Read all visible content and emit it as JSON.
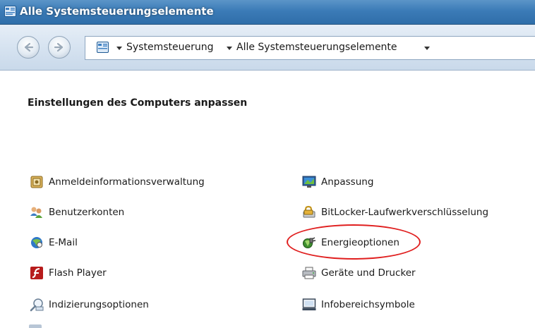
{
  "window": {
    "title": "Alle Systemsteuerungselemente",
    "title_icon": "control-panel-icon"
  },
  "navigation": {
    "back_icon": "back-arrow-icon",
    "forward_icon": "forward-arrow-icon",
    "breadcrumb": [
      "Systemsteuerung",
      "Alle Systemsteuerungselemente"
    ]
  },
  "main": {
    "heading": "Einstellungen des Computers anpassen",
    "items_left": [
      {
        "label": "Anmeldeinformationsverwaltung",
        "icon": "credential-manager-icon"
      },
      {
        "label": "Benutzerkonten",
        "icon": "user-accounts-icon"
      },
      {
        "label": "E-Mail",
        "icon": "mail-icon"
      },
      {
        "label": "Flash Player",
        "icon": "flash-player-icon"
      },
      {
        "label": "Indizierungsoptionen",
        "icon": "indexing-options-icon"
      }
    ],
    "items_right": [
      {
        "label": "Anpassung",
        "icon": "personalization-icon"
      },
      {
        "label": "BitLocker-Laufwerkverschlüsselung",
        "icon": "bitlocker-icon"
      },
      {
        "label": "Energieoptionen",
        "icon": "power-options-icon"
      },
      {
        "label": "Geräte und Drucker",
        "icon": "devices-printers-icon"
      },
      {
        "label": "Infobereichsymbole",
        "icon": "notification-icons-icon"
      }
    ]
  },
  "annotation": {
    "highlighted_item": "Energieoptionen",
    "color": "#e01f1f"
  }
}
